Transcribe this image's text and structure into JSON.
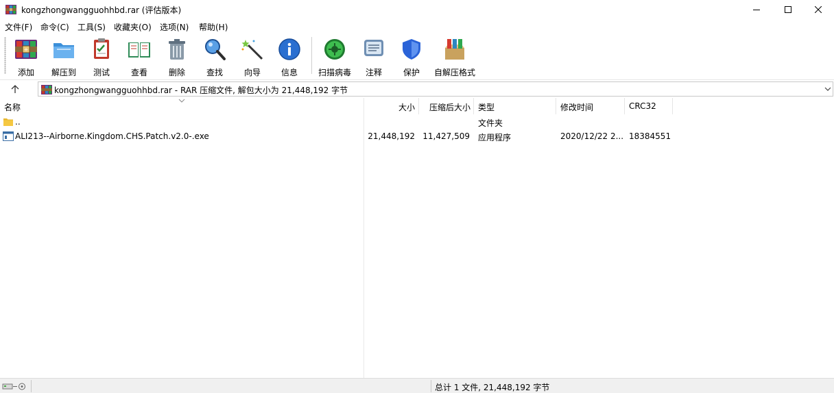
{
  "window": {
    "title": "kongzhongwangguohhbd.rar (评估版本)",
    "controls": [
      "minimize-icon",
      "maximize-icon",
      "close-icon"
    ]
  },
  "menu": {
    "file": "文件(F)",
    "commands": "命令(C)",
    "tools": "工具(S)",
    "favorites": "收藏夹(O)",
    "options": "选项(N)",
    "help": "帮助(H)"
  },
  "toolbar": {
    "add": "添加",
    "extract": "解压到",
    "test": "测试",
    "view": "查看",
    "delete": "删除",
    "find": "查找",
    "wizard": "向导",
    "info": "信息",
    "scan": "扫描病毒",
    "comment": "注释",
    "protect": "保护",
    "sfx": "自解压格式"
  },
  "address": {
    "text": "kongzhongwangguohhbd.rar - RAR 压缩文件, 解包大小为 21,448,192 字节"
  },
  "columns": {
    "name": "名称",
    "size": "大小",
    "packed": "压缩后大小",
    "type": "类型",
    "modified": "修改时间",
    "crc": "CRC32"
  },
  "rows": [
    {
      "name": "..",
      "size": "",
      "packed": "",
      "type": "文件夹",
      "modified": "",
      "crc": ""
    },
    {
      "name": "ALI213--Airborne.Kingdom.CHS.Patch.v2.0-.exe",
      "size": "21,448,192",
      "packed": "11,427,509",
      "type": "应用程序",
      "modified": "2020/12/22 2...",
      "crc": "18384551"
    }
  ],
  "status": {
    "summary": "总计 1 文件, 21,448,192 字节"
  },
  "colors": {
    "folder": "#f5c842",
    "accent": "#2a6fd0",
    "status_bg": "#f0f0f0"
  }
}
